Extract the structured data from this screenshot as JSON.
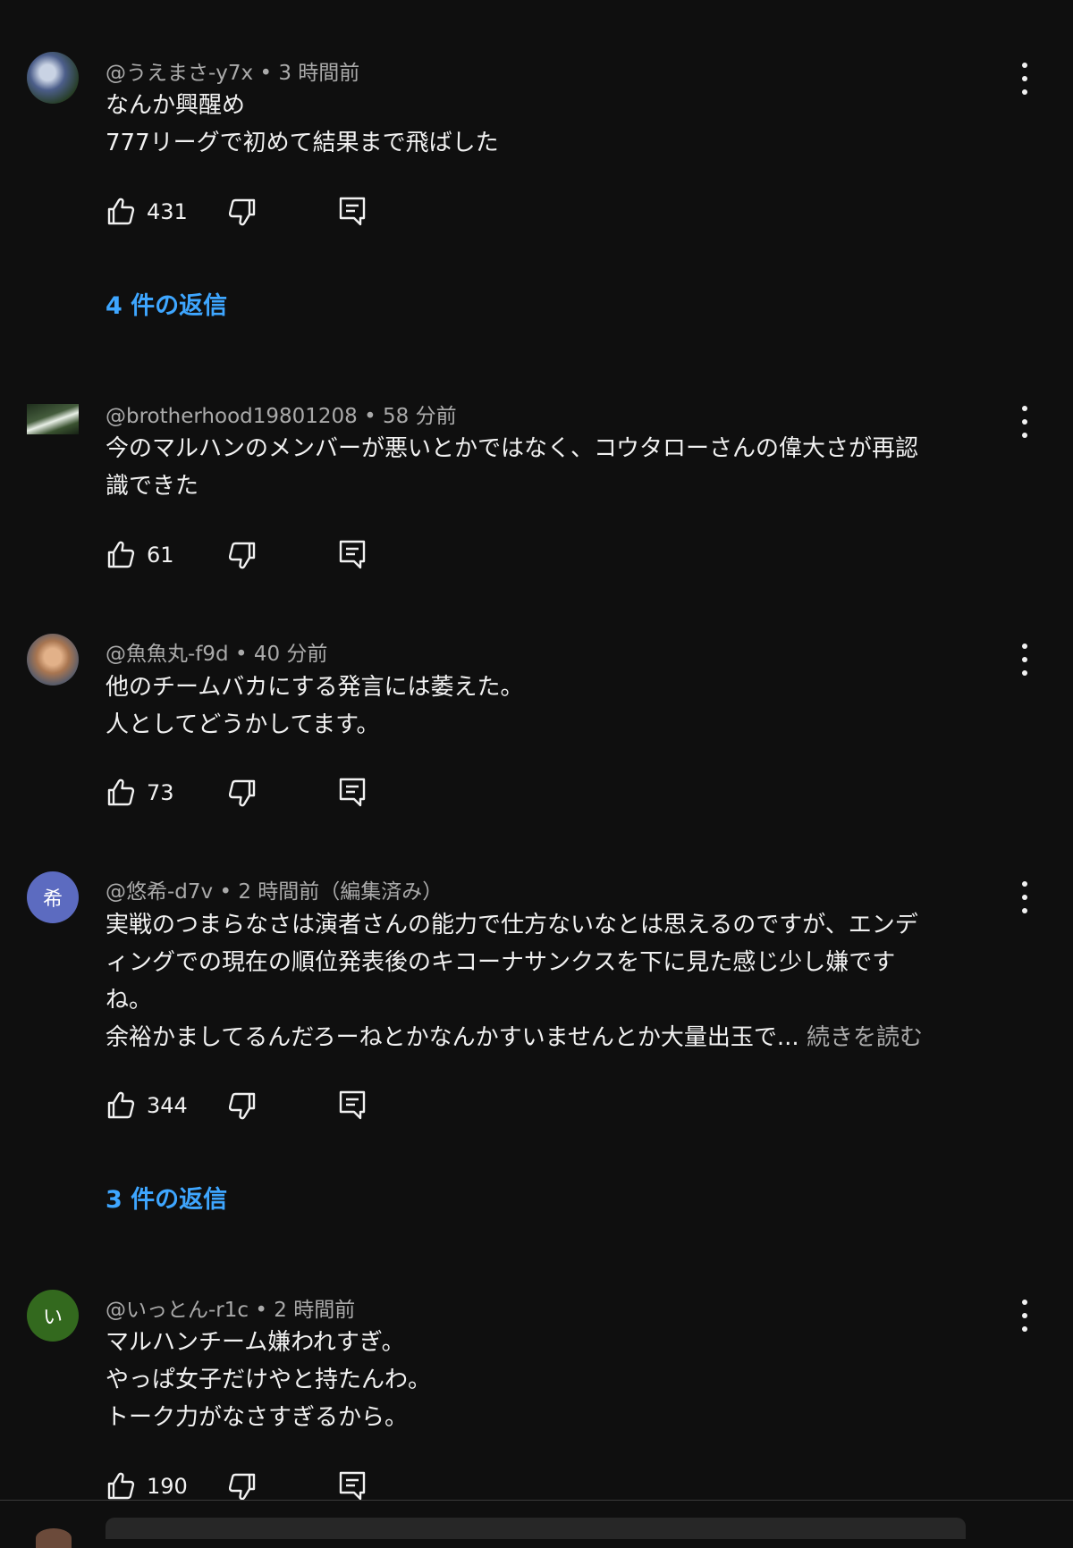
{
  "comments": [
    {
      "author": "@うえまさ-y7x",
      "time": "3 時間前",
      "lines": [
        "なんか興醒め",
        "777リーグで初めて結果まで飛ばした"
      ],
      "likes": "431",
      "replies": "4 件の返信"
    },
    {
      "author": "@brotherhood19801208",
      "time": "58 分前",
      "lines": [
        "今のマルハンのメンバーが悪いとかではなく、コウタローさんの偉大さが再認",
        "識できた"
      ],
      "likes": "61"
    },
    {
      "author": "@魚魚丸-f9d",
      "time": "40 分前",
      "lines": [
        "他のチームバカにする発言には萎えた。",
        "人としてどうかしてます。"
      ],
      "likes": "73"
    },
    {
      "author": "@悠希-d7v",
      "time": "2 時間前（編集済み）",
      "avatar_letter": "希",
      "avatar_color": "#5c6bc0",
      "lines": [
        "実戦のつまらなさは演者さんの能力で仕方ないなとは思えるのですが、エンデ",
        "ィングでの現在の順位発表後のキコーナサンクスを下に見た感じ少し嫌です",
        "ね。",
        "余裕かましてるんだろーねとかなんかすいませんとか大量出玉で..."
      ],
      "read_more": "続きを読む",
      "likes": "344",
      "replies": "3 件の返信"
    },
    {
      "author": "@いっとん-r1c",
      "time": "2 時間前",
      "avatar_letter": "い",
      "avatar_color": "#33691e",
      "lines": [
        "マルハンチーム嫌われすぎ。",
        "やっぱ女子だけやと持たんわ。",
        "トーク力がなさすぎるから。"
      ],
      "likes": "190"
    }
  ],
  "separator": " • ",
  "icons": {
    "like": "thumbs-up-icon",
    "dislike": "thumbs-down-icon",
    "reply": "reply-comment-icon",
    "menu": "more-vert-icon"
  },
  "colors": {
    "background": "#0f0f0f",
    "text": "#f1f1f1",
    "secondary": "#aaaaaa",
    "link": "#3ea6ff"
  }
}
